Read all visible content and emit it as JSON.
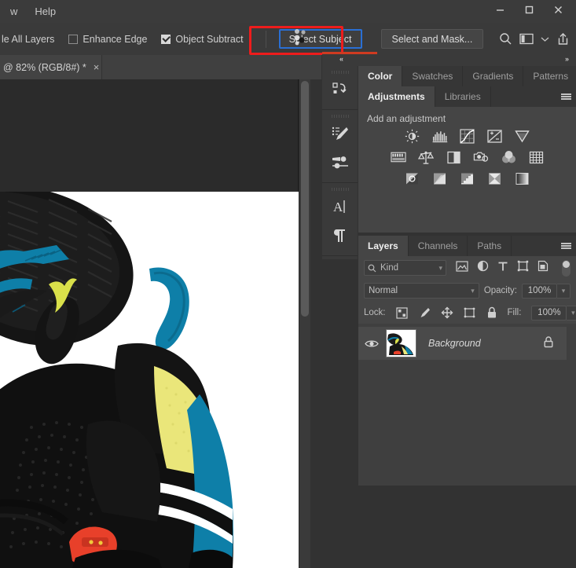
{
  "window": {
    "menus": [
      "w",
      "Help"
    ],
    "controls": [
      "minimize-icon",
      "maximize-icon",
      "close-icon"
    ]
  },
  "options_bar": {
    "sample_all_layers_label": "le All Layers",
    "sample_all_layers_checked": false,
    "enhance_edge_label": "Enhance Edge",
    "enhance_edge_checked": false,
    "object_subtract_label": "Object Subtract",
    "object_subtract_checked": true,
    "select_subject_label": "Select Subject",
    "select_and_mask_label": "Select and Mask...",
    "right_icons": [
      "search-icon",
      "workspace-icon",
      "chevron-down-icon",
      "share-icon"
    ],
    "highlight_color": "#ee1c1c",
    "focus_color": "#2a6fd4"
  },
  "document": {
    "tab_title": "@ 82% (RGB/8#) *",
    "close_label": "×",
    "zoom": "82%",
    "color_mode": "RGB/8#"
  },
  "dock": {
    "collapse_left_label": "«",
    "collapse_right_label": "»",
    "accent_color": "#cf3b21",
    "rail_icons": [
      "history-actions-icon",
      "brush-settings-icon",
      "brush-presets-icon",
      "character-icon",
      "paragraph-icon",
      "properties-icon"
    ]
  },
  "color_panel": {
    "tabs": [
      {
        "label": "Color",
        "active": true
      },
      {
        "label": "Swatches",
        "active": false
      },
      {
        "label": "Gradients",
        "active": false
      },
      {
        "label": "Patterns",
        "active": false
      }
    ],
    "menu_icon": "panel-menu-icon"
  },
  "adjustments_panel": {
    "tabs": [
      {
        "label": "Adjustments",
        "active": true
      },
      {
        "label": "Libraries",
        "active": false
      }
    ],
    "menu_icon": "panel-menu-icon",
    "title": "Add an adjustment",
    "rows": [
      [
        "brightness-contrast-icon",
        "levels-icon",
        "curves-icon",
        "exposure-icon",
        "vibrance-icon"
      ],
      [
        "hue-saturation-icon",
        "color-balance-icon",
        "black-white-icon",
        "photo-filter-icon",
        "channel-mixer-icon",
        "color-lookup-icon"
      ],
      [
        "invert-icon",
        "posterize-icon",
        "threshold-icon",
        "gradient-map-icon",
        "selective-color-icon"
      ]
    ]
  },
  "layers_panel": {
    "tabs": [
      {
        "label": "Layers",
        "active": true
      },
      {
        "label": "Channels",
        "active": false
      },
      {
        "label": "Paths",
        "active": false
      }
    ],
    "menu_icon": "panel-menu-icon",
    "filter": {
      "search_icon": "search-icon",
      "kind_label": "Kind",
      "type_icons": [
        "filter-image-icon",
        "filter-adjustment-icon",
        "filter-type-icon",
        "filter-shape-icon",
        "filter-smart-object-icon"
      ],
      "toggle": "filter-enable-toggle"
    },
    "blend_mode": "Normal",
    "opacity_label": "Opacity:",
    "opacity_value": "100%",
    "lock_label": "Lock:",
    "lock_icons": [
      "lock-transparent-pixels-icon",
      "lock-image-pixels-icon",
      "lock-position-icon",
      "lock-artboard-icon",
      "lock-all-icon"
    ],
    "fill_label": "Fill:",
    "fill_value": "100%",
    "layers": [
      {
        "name": "Background",
        "visible": true,
        "locked": true,
        "thumbnail": "sneaker-thumbnail",
        "selected": true
      }
    ]
  },
  "canvas": {
    "image_alt": "puma-sneaker-photo",
    "background_color": "#2b2b2b",
    "paper_color": "#ffffff",
    "colors": {
      "black": "#111111",
      "teal": "#0e7fa8",
      "yellow": "#eae67a",
      "red": "#e8402a",
      "white": "#ffffff"
    }
  }
}
